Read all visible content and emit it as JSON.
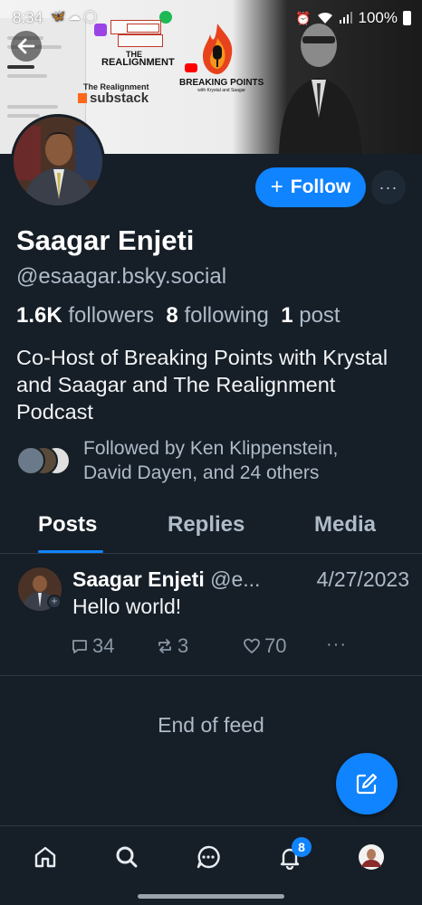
{
  "status_bar": {
    "time": "8:34",
    "battery": "100%"
  },
  "banner": {
    "realignment_logo_top": "THE",
    "realignment_logo_bottom": "REALIGNMENT",
    "realignment_sub": "The Realignment",
    "substack": "substack",
    "breaking_points": "BREAKING POINTS",
    "breaking_points_tag": "with Krystal and Saagar"
  },
  "profile": {
    "name": "Saagar Enjeti",
    "handle": "@esaagar.bsky.social",
    "followers_count": "1.6K",
    "followers_label": "followers",
    "following_count": "8",
    "following_label": "following",
    "posts_count": "1",
    "posts_label": "post",
    "bio": "Co-Host of Breaking Points with Krystal and Saagar and The Realignment Podcast",
    "followed_by_line1": "Followed by Ken Klippenstein,",
    "followed_by_line2": "David Dayen, and 24 others",
    "follow_button": "Follow"
  },
  "tabs": [
    {
      "label": "Posts",
      "active": true
    },
    {
      "label": "Replies",
      "active": false
    },
    {
      "label": "Media",
      "active": false
    }
  ],
  "post": {
    "author": "Saagar Enjeti",
    "handle": "@e...",
    "date": "4/27/2023",
    "text": "Hello world!",
    "replies": "34",
    "reposts": "3",
    "likes": "70"
  },
  "feed": {
    "end_text": "End of feed"
  },
  "nav": {
    "notifications_badge": "8"
  },
  "colors": {
    "background": "#161e27",
    "accent": "#1083fe",
    "muted_text": "#aebbc9"
  }
}
